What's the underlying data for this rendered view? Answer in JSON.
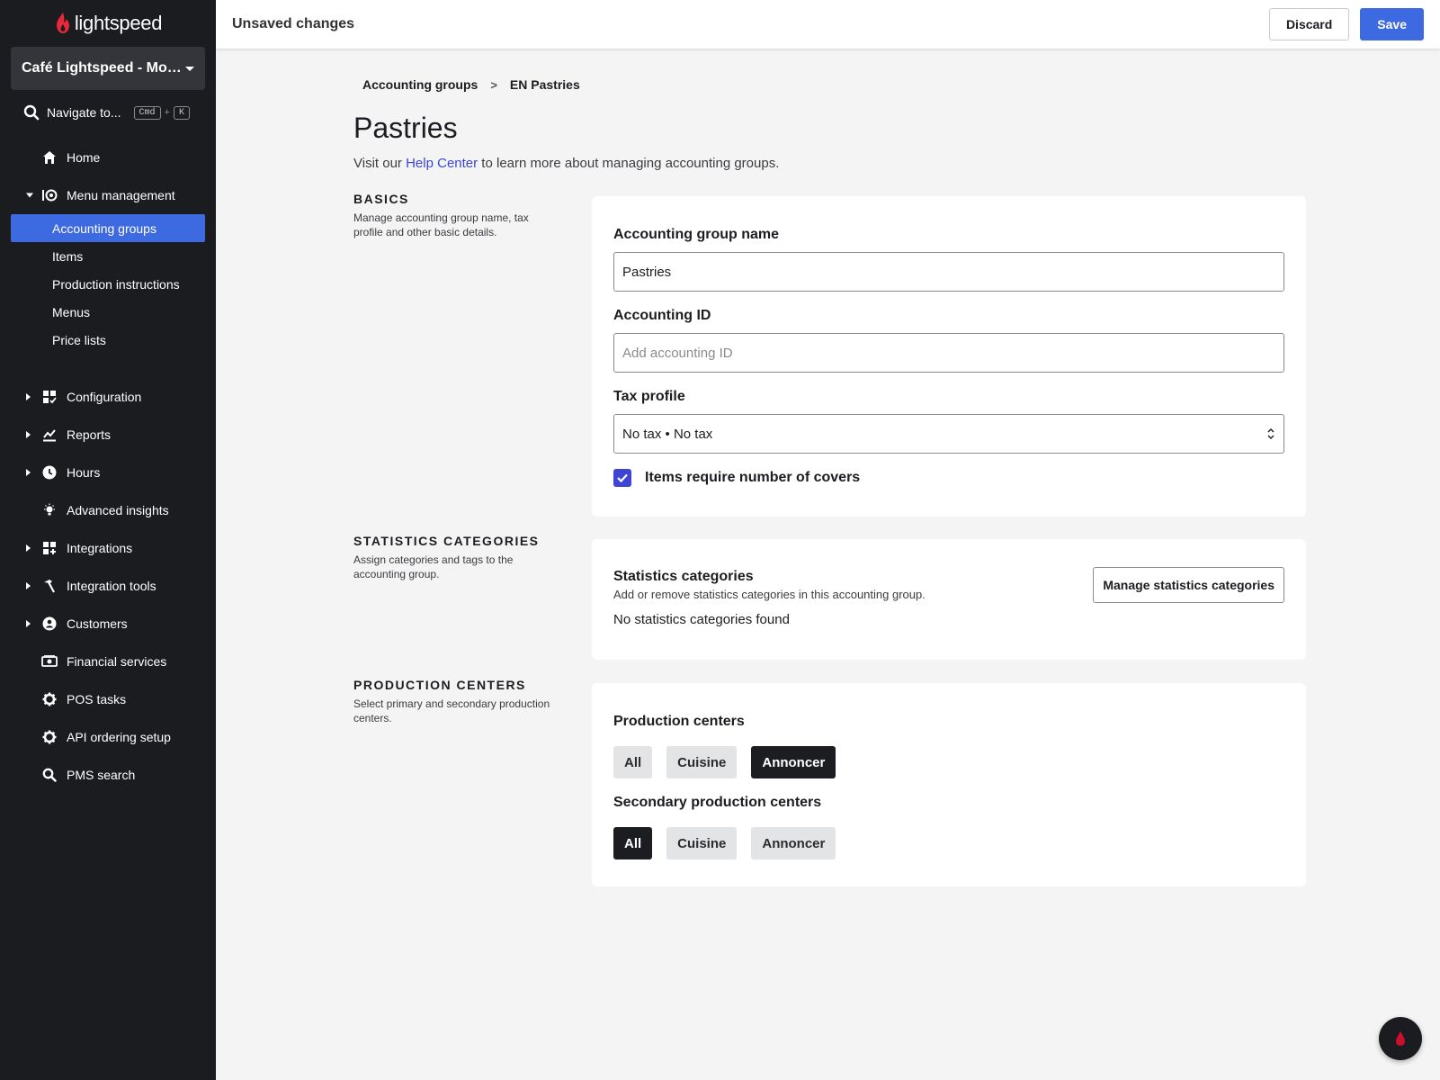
{
  "app": {
    "logo_text": "lightspeed"
  },
  "sidebar": {
    "store_name": "Café Lightspeed - Mon...",
    "navigate": {
      "label": "Navigate to...",
      "key1": "Cmd",
      "plus": "+",
      "key2": "K"
    },
    "items": [
      {
        "label": "Home",
        "icon": "home-icon"
      },
      {
        "label": "Menu management",
        "icon": "menu-management-icon",
        "expanded": true,
        "children": [
          {
            "label": "Accounting groups",
            "active": true
          },
          {
            "label": "Items"
          },
          {
            "label": "Production instructions"
          },
          {
            "label": "Menus"
          },
          {
            "label": "Price lists"
          }
        ]
      },
      {
        "label": "Configuration",
        "icon": "configuration-icon"
      },
      {
        "label": "Reports",
        "icon": "reports-icon"
      },
      {
        "label": "Hours",
        "icon": "clock-icon"
      },
      {
        "label": "Advanced insights",
        "icon": "lightbulb-icon"
      },
      {
        "label": "Integrations",
        "icon": "integrations-icon"
      },
      {
        "label": "Integration tools",
        "icon": "hammer-icon"
      },
      {
        "label": "Customers",
        "icon": "customer-icon"
      },
      {
        "label": "Financial services",
        "icon": "money-icon"
      },
      {
        "label": "POS tasks",
        "icon": "gear-icon"
      },
      {
        "label": "API ordering setup",
        "icon": "gear-icon"
      },
      {
        "label": "PMS search",
        "icon": "search-icon"
      }
    ]
  },
  "topbar": {
    "title": "Unsaved changes",
    "discard_label": "Discard",
    "save_label": "Save"
  },
  "breadcrumb": {
    "parent": "Accounting groups",
    "separator": ">",
    "current": "EN Pastries"
  },
  "page": {
    "title": "Pastries",
    "subtitle_pre": "Visit our ",
    "subtitle_link": "Help Center",
    "subtitle_post": " to learn more about managing accounting groups."
  },
  "basics": {
    "heading": "BASICS",
    "description": "Manage accounting group name, tax profile and other basic details.",
    "name_label": "Accounting group name",
    "name_value": "Pastries",
    "id_label": "Accounting ID",
    "id_placeholder": "Add accounting ID",
    "tax_label": "Tax profile",
    "tax_value": "No tax • No tax",
    "covers_label": "Items require number of covers",
    "covers_checked": true
  },
  "statistics": {
    "heading": "STATISTICS CATEGORIES",
    "description": "Assign categories and tags to the accounting group.",
    "title": "Statistics categories",
    "subtitle": "Add or remove statistics categories in this accounting group.",
    "manage_label": "Manage statistics categories",
    "empty_text": "No statistics categories found"
  },
  "production": {
    "heading": "PRODUCTION CENTERS",
    "description": "Select primary and secondary production centers.",
    "primary_label": "Production centers",
    "primary_options": [
      "All",
      "Cuisine",
      "Annoncer"
    ],
    "primary_selected": "Annoncer",
    "secondary_label": "Secondary production centers",
    "secondary_options": [
      "All",
      "Cuisine",
      "Annoncer"
    ],
    "secondary_selected": "All"
  },
  "colors": {
    "accent": "#3e6ae1",
    "sidebar_bg": "#1b1c20",
    "checkbox": "#3e45d6",
    "logo_flame": "#e8283a"
  }
}
